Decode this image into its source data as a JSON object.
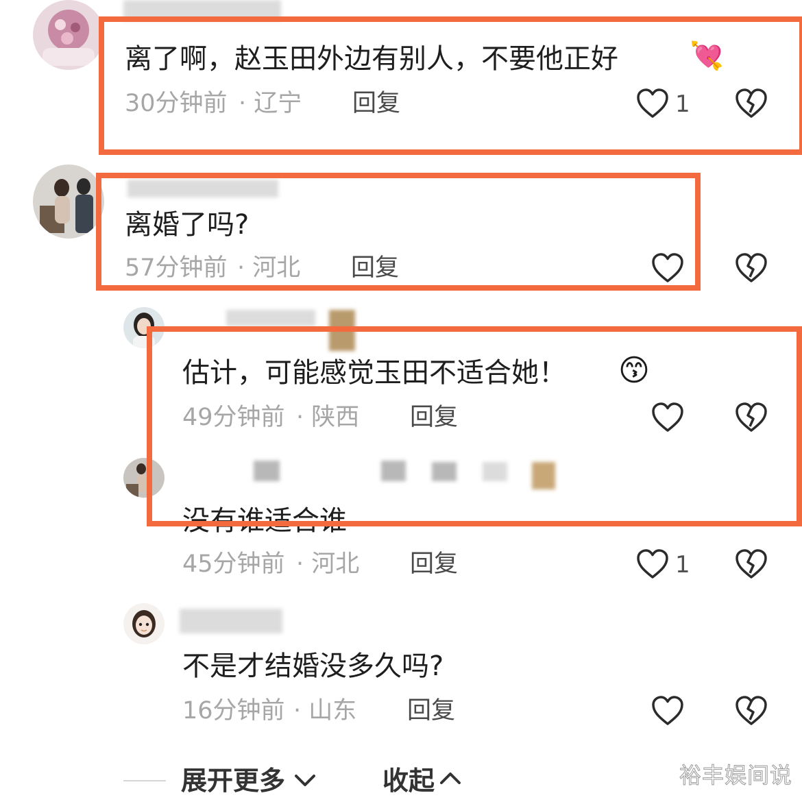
{
  "comments": [
    {
      "text": "离了啊，赵玉田外边有别人，不要他正好",
      "emoji": "💘",
      "time": "30分钟前",
      "location": "· 辽宁",
      "reply_label": "回复",
      "likes": "1"
    },
    {
      "text": "离婚了吗?",
      "time": "57分钟前",
      "location": "· 河北",
      "reply_label": "回复",
      "likes": ""
    },
    {
      "text": "估计，可能感觉玉田不适合她！",
      "emoji": "😙",
      "time": "49分钟前",
      "location": "· 陕西",
      "reply_label": "回复",
      "likes": ""
    },
    {
      "text": "没有谁适合谁",
      "time": "45分钟前",
      "location": "· 河北",
      "reply_label": "回复",
      "likes": "1"
    },
    {
      "text": "不是才结婚没多久吗?",
      "time": "16分钟前",
      "location": "· 山东",
      "reply_label": "回复",
      "likes": ""
    }
  ],
  "footer": {
    "expand_label": "展开更多",
    "collapse_label": "收起"
  },
  "watermark": "裕丰娱间说",
  "colors": {
    "highlight_box": "#f26a3d",
    "meta_text": "#a6a6a6",
    "body_text": "#1e1e1e"
  },
  "icons": [
    "heart-outline-icon",
    "broken-heart-icon",
    "chevron-down-icon",
    "chevron-up-icon"
  ]
}
